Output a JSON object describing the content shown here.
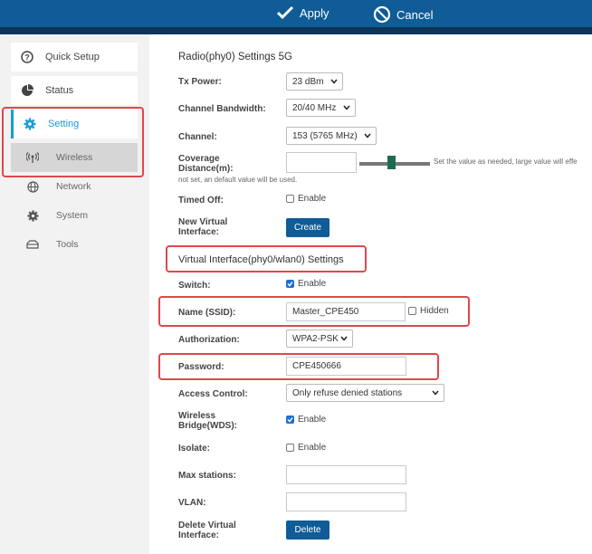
{
  "toolbar": {
    "apply_label": "Apply",
    "cancel_label": "Cancel"
  },
  "sidebar": {
    "items": [
      {
        "label": "Quick Setup",
        "icon": "help-circle-icon"
      },
      {
        "label": "Status",
        "icon": "pie-chart-icon"
      },
      {
        "label": "Setting",
        "icon": "gear-icon"
      },
      {
        "label": "Wireless",
        "icon": "antenna-icon"
      },
      {
        "label": "Network",
        "icon": "globe-icon"
      },
      {
        "label": "System",
        "icon": "gear-icon"
      },
      {
        "label": "Tools",
        "icon": "toolbox-icon"
      }
    ]
  },
  "radio": {
    "title": "Radio(phy0) Settings 5G",
    "tx_power_label": "Tx Power:",
    "tx_power_value": "23 dBm",
    "bandwidth_label": "Channel Bandwidth:",
    "bandwidth_value": "20/40 MHz",
    "channel_label": "Channel:",
    "channel_value": "153 (5765 MHz)",
    "coverage_label": "Coverage Distance(m):",
    "coverage_value": "",
    "coverage_slider_fraction": 0.45,
    "coverage_hint": "Set the value as needed, large value will effe",
    "coverage_note": "not set, an default value will be used.",
    "timed_off_label": "Timed Off:",
    "timed_off_option": "Enable",
    "new_vif_label": "New Virtual Interface:",
    "create_label": "Create"
  },
  "vif": {
    "title": "Virtual Interface(phy0/wlan0) Settings",
    "switch_label": "Switch:",
    "switch_option": "Enable",
    "ssid_label": "Name (SSID):",
    "ssid_value": "Master_CPE450",
    "hidden_option": "Hidden",
    "auth_label": "Authorization:",
    "auth_value": "WPA2-PSK",
    "password_label": "Password:",
    "password_value": "CPE450666",
    "access_label": "Access Control:",
    "access_value": "Only refuse denied stations",
    "wds_label": "Wireless Bridge(WDS):",
    "wds_option": "Enable",
    "isolate_label": "Isolate:",
    "isolate_option": "Enable",
    "max_label": "Max stations:",
    "max_value": "",
    "vlan_label": "VLAN:",
    "vlan_value": "",
    "delete_vif_label": "Delete Virtual Interface:",
    "delete_label": "Delete"
  },
  "colors": {
    "brand": "#0f5c96",
    "accent": "#1e9ad6",
    "highlight": "#e0474c"
  }
}
